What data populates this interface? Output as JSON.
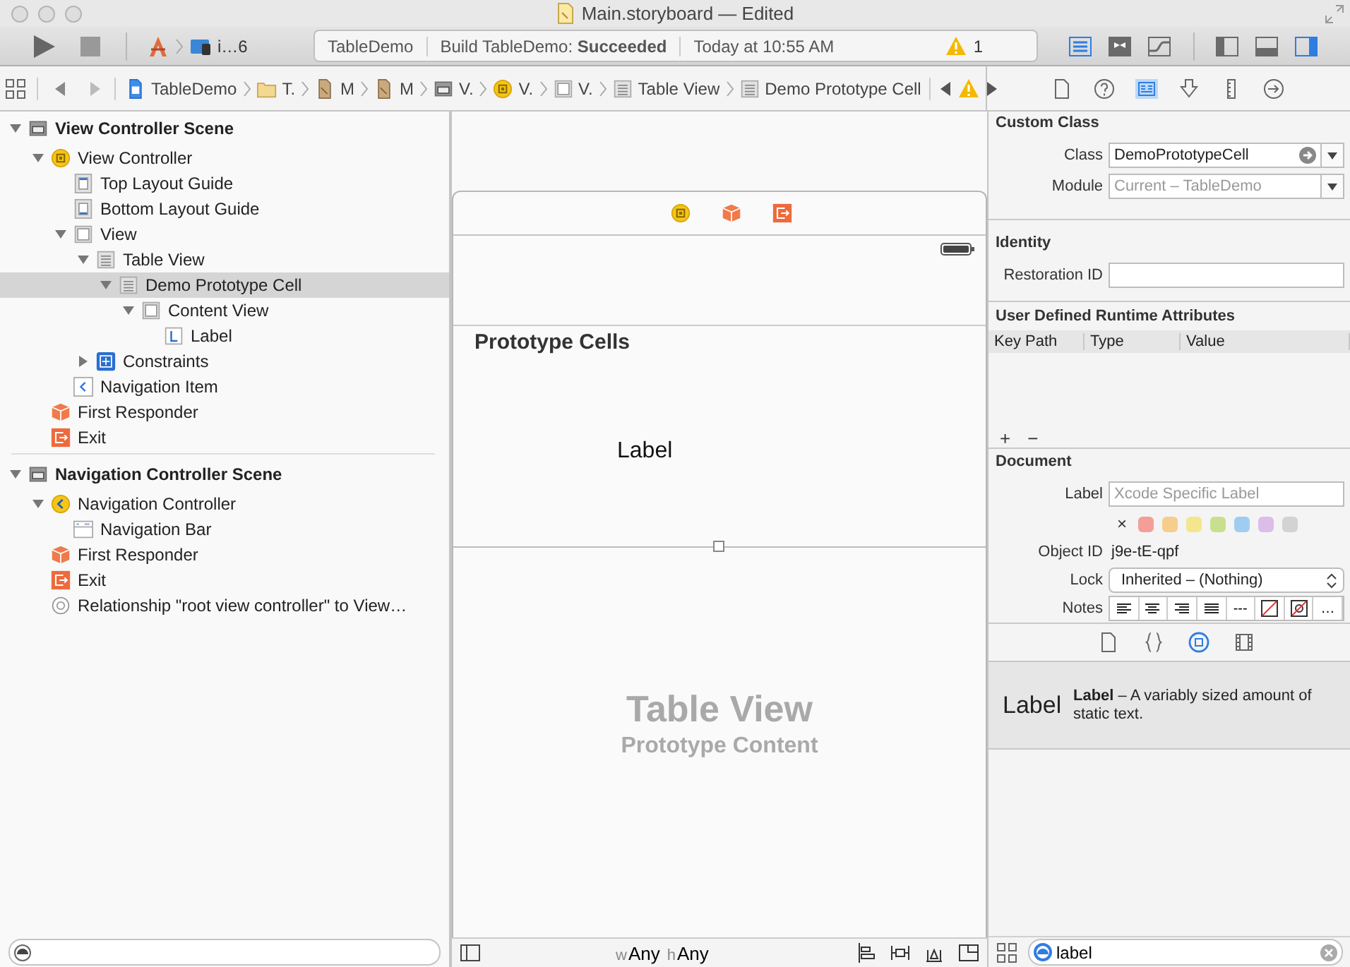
{
  "window": {
    "title": "Main.storyboard — Edited"
  },
  "toolbar": {
    "scheme": "i…6",
    "activity": {
      "project": "TableDemo",
      "status": "Build TableDemo: **Succeeded**",
      "time": "Today at 10:55 AM",
      "warnings": "1"
    },
    "editor_modes": [
      {
        "kind": "standard",
        "selected": true
      },
      {
        "kind": "assistant",
        "selected": false
      },
      {
        "kind": "version",
        "selected": false
      }
    ],
    "panels": [
      {
        "kind": "navigator",
        "on": false
      },
      {
        "kind": "debug",
        "on": false
      },
      {
        "kind": "utilities",
        "on": true
      }
    ]
  },
  "jump_bar": {
    "items": [
      {
        "kind": "project",
        "label": "TableDemo"
      },
      {
        "kind": "folder",
        "label": "T."
      },
      {
        "kind": "storyboard",
        "label": "M"
      },
      {
        "kind": "storyboard",
        "label": "M"
      },
      {
        "kind": "scene",
        "label": "V."
      },
      {
        "kind": "controller",
        "label": "V."
      },
      {
        "kind": "view",
        "label": "V."
      },
      {
        "kind": "table",
        "label": "Table View"
      },
      {
        "kind": "table",
        "label": "Demo Prototype Cell"
      }
    ]
  },
  "inspector_tabs": [
    {
      "kind": "file",
      "selected": false
    },
    {
      "kind": "help",
      "selected": false
    },
    {
      "kind": "identity",
      "selected": true
    },
    {
      "kind": "attributes",
      "selected": false
    },
    {
      "kind": "size",
      "selected": false
    },
    {
      "kind": "connections",
      "selected": false
    }
  ],
  "outline": {
    "scenes": [
      {
        "kind": "scene",
        "label": "View Controller Scene",
        "expanded": true,
        "selected": false,
        "children": [
          {
            "kind": "controller",
            "label": "View Controller",
            "expanded": true,
            "selected": false,
            "children": [
              {
                "kind": "guide-top",
                "label": "Top Layout Guide",
                "selected": false
              },
              {
                "kind": "guide-bottom",
                "label": "Bottom Layout Guide",
                "selected": false
              },
              {
                "kind": "view",
                "label": "View",
                "expanded": true,
                "selected": false,
                "children": [
                  {
                    "kind": "table",
                    "label": "Table View",
                    "expanded": true,
                    "selected": false,
                    "children": [
                      {
                        "kind": "table",
                        "label": "Demo Prototype Cell",
                        "expanded": true,
                        "selected": true,
                        "children": [
                          {
                            "kind": "view",
                            "label": "Content View",
                            "expanded": true,
                            "selected": false,
                            "children": [
                              {
                                "kind": "label",
                                "label": "Label",
                                "selected": false
                              }
                            ]
                          }
                        ]
                      }
                    ]
                  },
                  {
                    "kind": "constraints",
                    "label": "Constraints",
                    "expanded": false,
                    "selected": false
                  }
                ]
              },
              {
                "kind": "navitem",
                "label": "Navigation Item",
                "selected": false
              }
            ]
          },
          {
            "kind": "responder",
            "label": "First Responder",
            "selected": false
          },
          {
            "kind": "exit",
            "label": "Exit",
            "selected": false
          }
        ]
      },
      {
        "kind": "scene",
        "label": "Navigation Controller Scene",
        "expanded": true,
        "selected": false,
        "children": [
          {
            "kind": "navctrl",
            "label": "Navigation Controller",
            "expanded": true,
            "selected": false,
            "children": [
              {
                "kind": "navbar",
                "label": "Navigation Bar",
                "selected": false
              }
            ]
          },
          {
            "kind": "responder",
            "label": "First Responder",
            "selected": false
          },
          {
            "kind": "exit",
            "label": "Exit",
            "selected": false
          },
          {
            "kind": "relationship",
            "label": "Relationship \"root view controller\" to View…",
            "selected": false
          }
        ]
      }
    ]
  },
  "canvas": {
    "dock": [
      {
        "kind": "controller"
      },
      {
        "kind": "responder"
      },
      {
        "kind": "exit"
      }
    ],
    "section_header": "Prototype Cells",
    "cell_label": "Label",
    "placeholder_title": "Table View",
    "placeholder_subtitle": "Prototype Content",
    "size_class": {
      "w_prefix": "w",
      "w": "Any",
      "h_prefix": "h",
      "h": "Any"
    }
  },
  "inspector": {
    "custom_class": {
      "title": "Custom Class",
      "class_label": "Class",
      "class_value": "DemoPrototypeCell",
      "module_label": "Module",
      "module_placeholder": "Current – TableDemo"
    },
    "identity": {
      "title": "Identity",
      "restoration_label": "Restoration ID"
    },
    "runtime_attributes": {
      "title": "User Defined Runtime Attributes",
      "columns": [
        "Key Path",
        "Type",
        "Value"
      ],
      "add": "+",
      "remove": "−"
    },
    "document": {
      "title": "Document",
      "label_label": "Label",
      "label_placeholder": "Xcode Specific Label",
      "clear_color": "×",
      "colors": [
        {
          "color": "#f49e98"
        },
        {
          "color": "#f6cd8d"
        },
        {
          "color": "#f3e68d"
        },
        {
          "color": "#c8e08e"
        },
        {
          "color": "#9fcdf1"
        },
        {
          "color": "#dcbdea"
        },
        {
          "color": "#d3d3d3"
        }
      ],
      "object_id_label": "Object ID",
      "object_id": "j9e-tE-qpf",
      "lock_label": "Lock",
      "lock_value": "Inherited – (Nothing)",
      "notes_label": "Notes",
      "notes_buttons": [
        {
          "kind": "align-left"
        },
        {
          "kind": "align-center"
        },
        {
          "kind": "align-right"
        },
        {
          "kind": "justify"
        },
        {
          "kind": "text",
          "label": "---"
        },
        {
          "kind": "no-color"
        },
        {
          "kind": "no-text-color"
        },
        {
          "kind": "text",
          "label": "…"
        }
      ]
    }
  },
  "library": {
    "tabs": [
      {
        "kind": "file",
        "selected": false
      },
      {
        "kind": "code",
        "selected": false
      },
      {
        "kind": "object",
        "selected": true
      },
      {
        "kind": "media",
        "selected": false
      }
    ],
    "items": [
      {
        "preview": "Label",
        "description": "**Label** – A variably sized amount of static text."
      }
    ],
    "search": {
      "value": "label"
    }
  }
}
